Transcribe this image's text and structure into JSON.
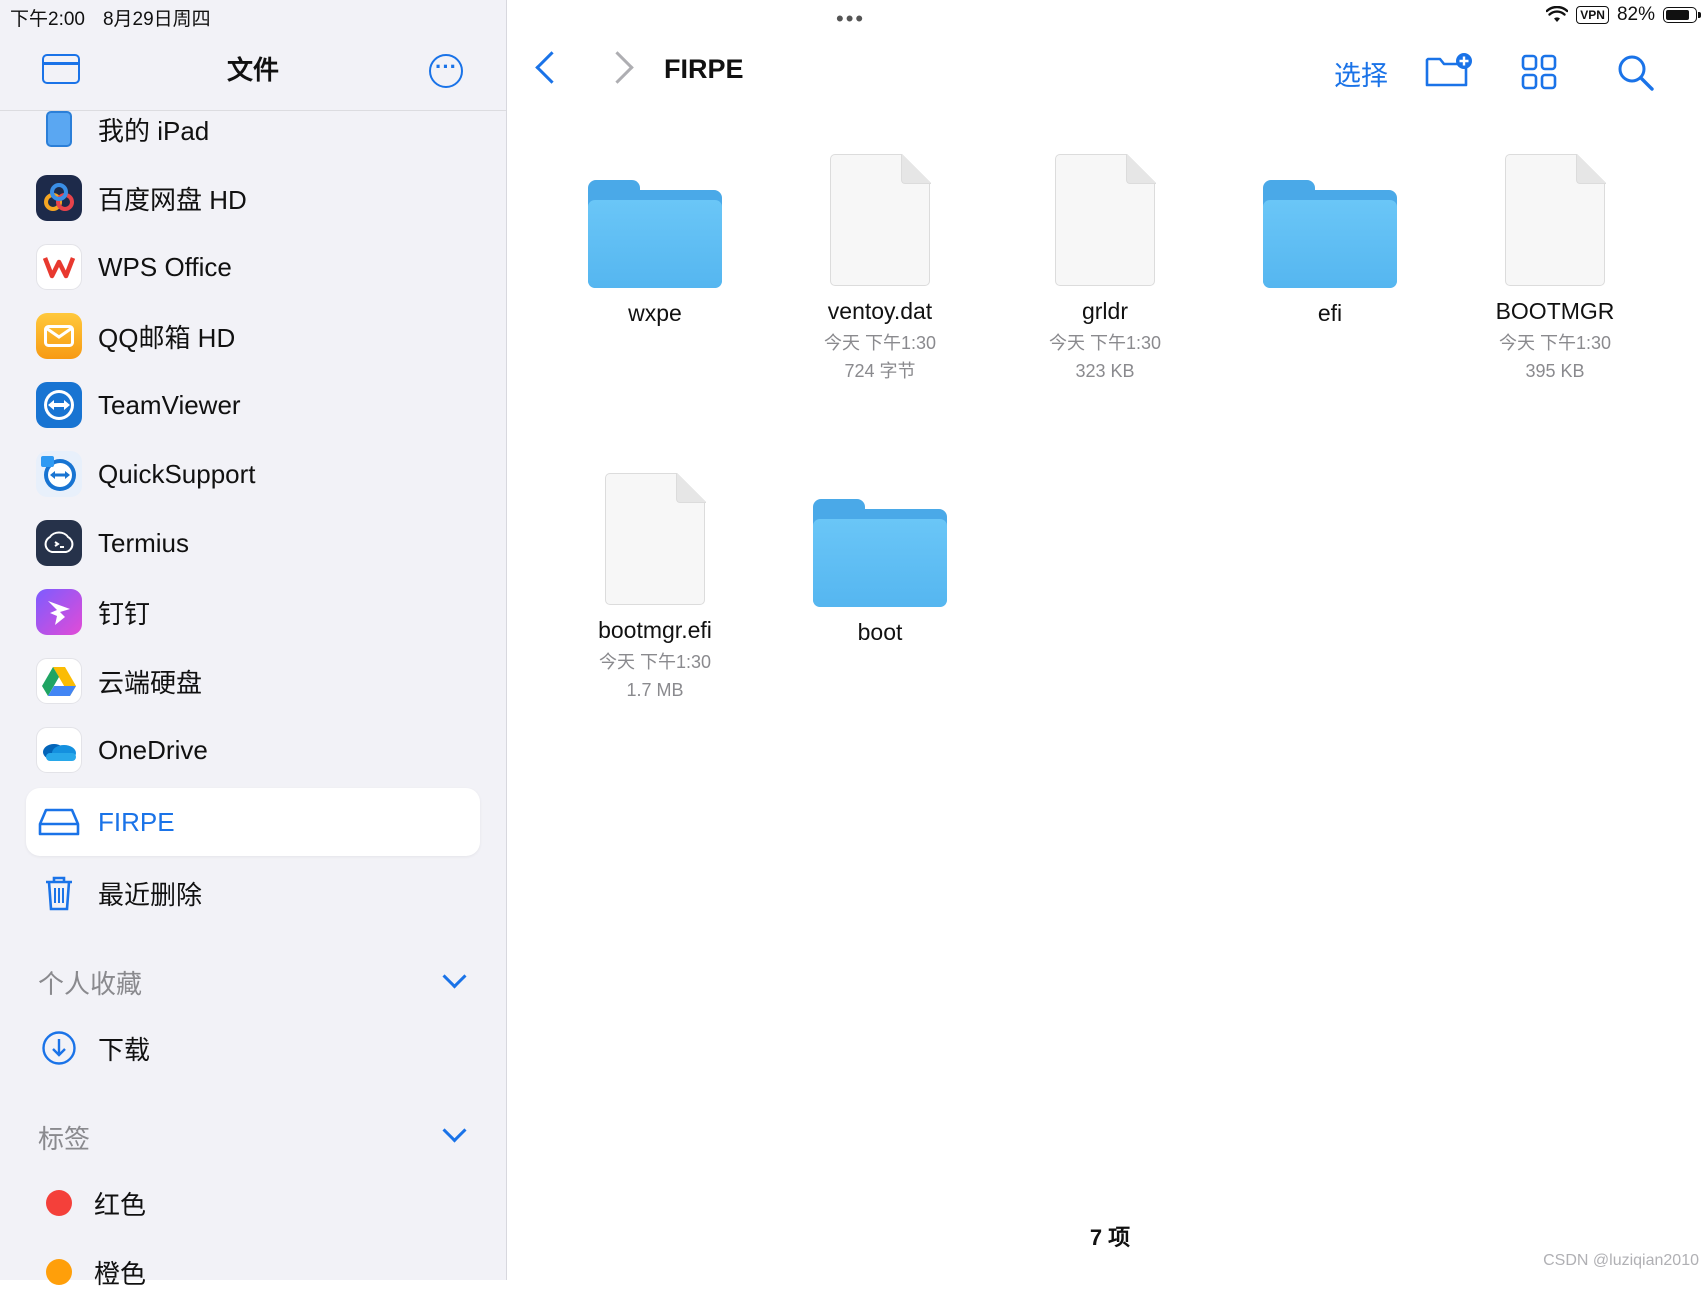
{
  "status": {
    "time": "下午2:00",
    "date": "8月29日周四",
    "vpn": "VPN",
    "battery": "82%",
    "battery_level": 0.82,
    "more": "•••"
  },
  "sidebar": {
    "title": "文件",
    "more_glyph": "···",
    "locations": [
      {
        "label": "我的 iPad",
        "icon": "ipad-icon",
        "color": "#3a8ee6"
      },
      {
        "label": "百度网盘 HD",
        "icon": "baidu-netdisk-icon",
        "color": "#1d2a4a"
      },
      {
        "label": "WPS Office",
        "icon": "wps-icon",
        "color": "#ffffff"
      },
      {
        "label": "QQ邮箱 HD",
        "icon": "qq-mail-icon",
        "color": "#f7a31c"
      },
      {
        "label": "TeamViewer",
        "icon": "teamviewer-icon",
        "color": "#1874d2"
      },
      {
        "label": "QuickSupport",
        "icon": "quicksupport-icon",
        "color": "#1874d2"
      },
      {
        "label": "Termius",
        "icon": "termius-icon",
        "color": "#26324a"
      },
      {
        "label": "钉钉",
        "icon": "dingtalk-icon",
        "color": "#6b4cf5"
      },
      {
        "label": "云端硬盘",
        "icon": "google-drive-icon",
        "color": "#ffffff"
      },
      {
        "label": "OneDrive",
        "icon": "onedrive-icon",
        "color": "#ffffff"
      },
      {
        "label": "FIRPE",
        "icon": "drive-icon",
        "color": "#ffffff"
      },
      {
        "label": "最近删除",
        "icon": "trash-icon",
        "color": "#f2f2f7"
      }
    ],
    "favorites_heading": "个人收藏",
    "favorites": [
      {
        "label": "下载",
        "icon": "download-icon"
      }
    ],
    "tags_heading": "标签",
    "tags": [
      {
        "label": "红色",
        "color": "#f4403a"
      },
      {
        "label": "橙色",
        "color": "#ff9f0a"
      }
    ]
  },
  "main": {
    "title": "FIRPE",
    "select_label": "选择",
    "files": [
      {
        "name": "wxpe",
        "kind": "folder"
      },
      {
        "name": "ventoy.dat",
        "kind": "file",
        "date": "今天 下午1:30",
        "size": "724 字节"
      },
      {
        "name": "grldr",
        "kind": "file",
        "date": "今天 下午1:30",
        "size": "323 KB"
      },
      {
        "name": "efi",
        "kind": "folder"
      },
      {
        "name": "BOOTMGR",
        "kind": "file",
        "date": "今天 下午1:30",
        "size": "395 KB"
      },
      {
        "name": "bootmgr.efi",
        "kind": "file",
        "date": "今天 下午1:30",
        "size": "1.7 MB"
      },
      {
        "name": "boot",
        "kind": "folder"
      }
    ],
    "item_count": "7 项"
  },
  "watermark": "CSDN @luziqian2010"
}
